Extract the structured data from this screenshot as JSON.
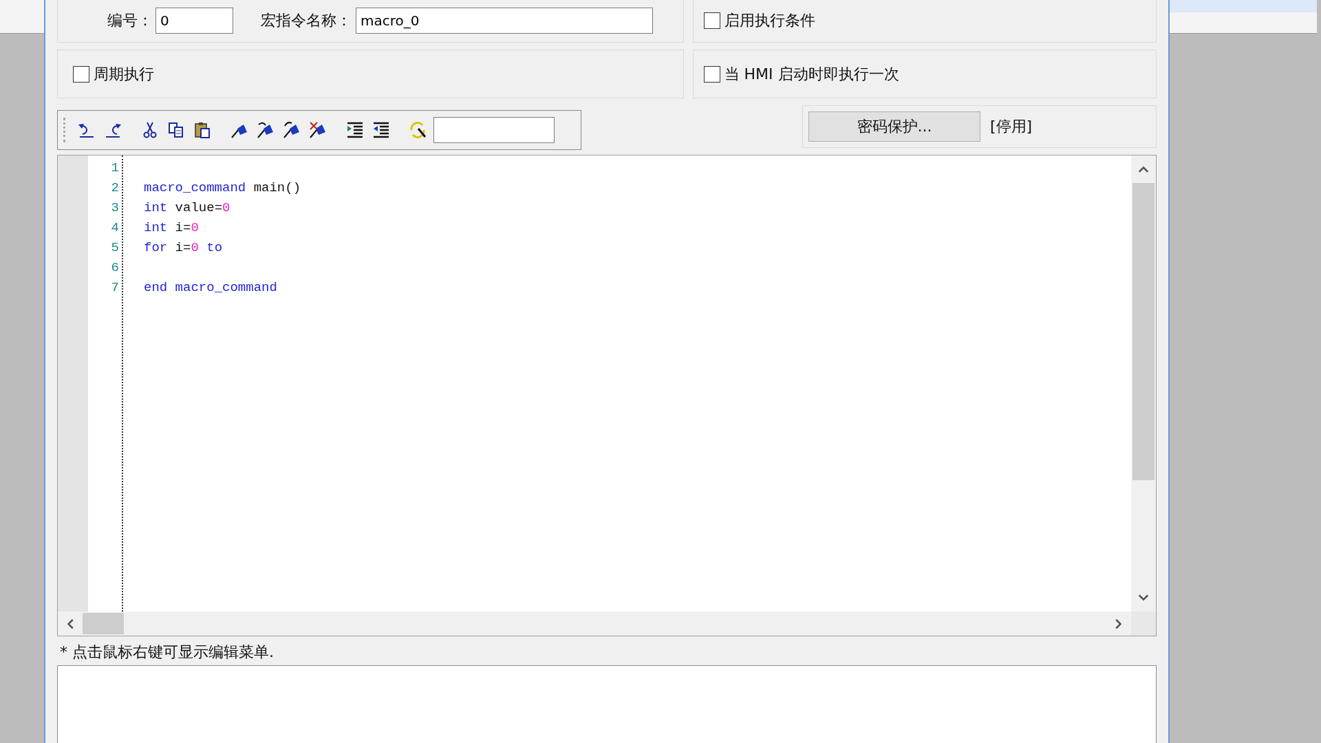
{
  "macro_id": {
    "label": "编号：",
    "value": "0"
  },
  "macro_name": {
    "label": "宏指令名称：",
    "value": "macro_0"
  },
  "enable_condition": {
    "label": "启用执行条件",
    "checked": false
  },
  "periodic": {
    "label": "周期执行",
    "checked": false
  },
  "run_on_start": {
    "label": "当 HMI 启动时即执行一次",
    "checked": false
  },
  "toolbar": [
    {
      "kind": "undo"
    },
    {
      "kind": "redo"
    },
    {
      "kind": "sep"
    },
    {
      "kind": "cut"
    },
    {
      "kind": "copy"
    },
    {
      "kind": "paste"
    },
    {
      "kind": "sep"
    },
    {
      "kind": "flag"
    },
    {
      "kind": "flag-next"
    },
    {
      "kind": "flag-prev"
    },
    {
      "kind": "flag-clear"
    },
    {
      "kind": "sep"
    },
    {
      "kind": "indent"
    },
    {
      "kind": "outdent"
    },
    {
      "kind": "sep"
    },
    {
      "kind": "replace"
    }
  ],
  "password": {
    "button": "密码保护...",
    "status": "[停用]"
  },
  "editor": {
    "lines": [
      {
        "number": "1"
      },
      {
        "number": "2",
        "tokens": [
          {
            "kind": "keyword",
            "text": "macro_command"
          },
          {
            "kind": "plain",
            "text": " main()"
          }
        ]
      },
      {
        "number": "3",
        "tokens": [
          {
            "kind": "keyword",
            "text": "int"
          },
          {
            "kind": "plain",
            "text": " value="
          },
          {
            "kind": "number",
            "text": "0"
          }
        ]
      },
      {
        "number": "4",
        "tokens": [
          {
            "kind": "keyword",
            "text": "int"
          },
          {
            "kind": "plain",
            "text": " i="
          },
          {
            "kind": "number",
            "text": "0"
          }
        ]
      },
      {
        "number": "5",
        "tokens": [
          {
            "kind": "keyword",
            "text": "for"
          },
          {
            "kind": "plain",
            "text": " i="
          },
          {
            "kind": "number",
            "text": "0"
          },
          {
            "kind": "keyword",
            "text": " to"
          }
        ]
      },
      {
        "number": "6"
      },
      {
        "number": "7",
        "tokens": [
          {
            "kind": "keyword",
            "text": "end macro_command"
          }
        ]
      }
    ]
  },
  "hint": "* 点击鼠标右键可显示编辑菜单."
}
